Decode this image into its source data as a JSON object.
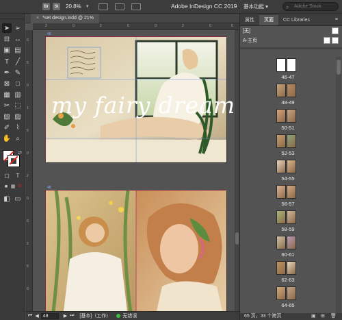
{
  "app": {
    "title": "Adobe InDesign CC 2019",
    "zoom": "20.8%",
    "workspace": "基本功能",
    "workspace_caret": "▾",
    "search_placeholder": "Adobe Stock",
    "chip_br": "Br",
    "chip_st": "St"
  },
  "document": {
    "tab_label": "*set design.indd @ 21%",
    "close_glyph": "×"
  },
  "rulers": {
    "top_ticks": [
      "2",
      "0",
      "2",
      "0",
      "0",
      "2",
      "0",
      "0"
    ],
    "left_ticks": [
      "0",
      "5",
      "0",
      "1",
      "5",
      "0",
      "2",
      "0",
      "0",
      "2",
      "5",
      "0"
    ]
  },
  "spread1": {
    "script_title": "my fairy dream",
    "page_label": "46"
  },
  "spread2": {
    "page_label": "48"
  },
  "statusbar": {
    "page": "48",
    "layer": "[基本]（工作）",
    "errors": "无错误"
  },
  "panel": {
    "tabs": [
      "属性",
      "页面",
      "CC Libraries"
    ],
    "active_tab": 1,
    "masters": [
      {
        "label": "[无]"
      },
      {
        "label": "A-主页"
      }
    ],
    "spreads": [
      {
        "label": "46-47",
        "colors": [
          "#ffffff",
          "#ffffff"
        ]
      },
      {
        "label": "48-49",
        "colors": [
          "#c9a57a",
          "#b78a62"
        ]
      },
      {
        "label": "50-51",
        "colors": [
          "#d7a27a",
          "#caa483"
        ]
      },
      {
        "label": "52-53",
        "colors": [
          "#c79c6c",
          "#8ea27a"
        ]
      },
      {
        "label": "54-55",
        "colors": [
          "#ead6c0",
          "#d9b48e"
        ]
      },
      {
        "label": "56-57",
        "colors": [
          "#e0b496",
          "#d3a881"
        ]
      },
      {
        "label": "58-59",
        "colors": [
          "#a8b87a",
          "#d1b89a"
        ]
      },
      {
        "label": "60-61",
        "colors": [
          "#cfc3a8",
          "#b79ab8"
        ]
      },
      {
        "label": "62-63",
        "colors": [
          "#c0925f",
          "#e8d8c0"
        ]
      },
      {
        "label": "64-65",
        "colors": [
          "#d4aa7e",
          "#c3a38a"
        ]
      }
    ],
    "footer": "65 页，33 个跨页"
  }
}
